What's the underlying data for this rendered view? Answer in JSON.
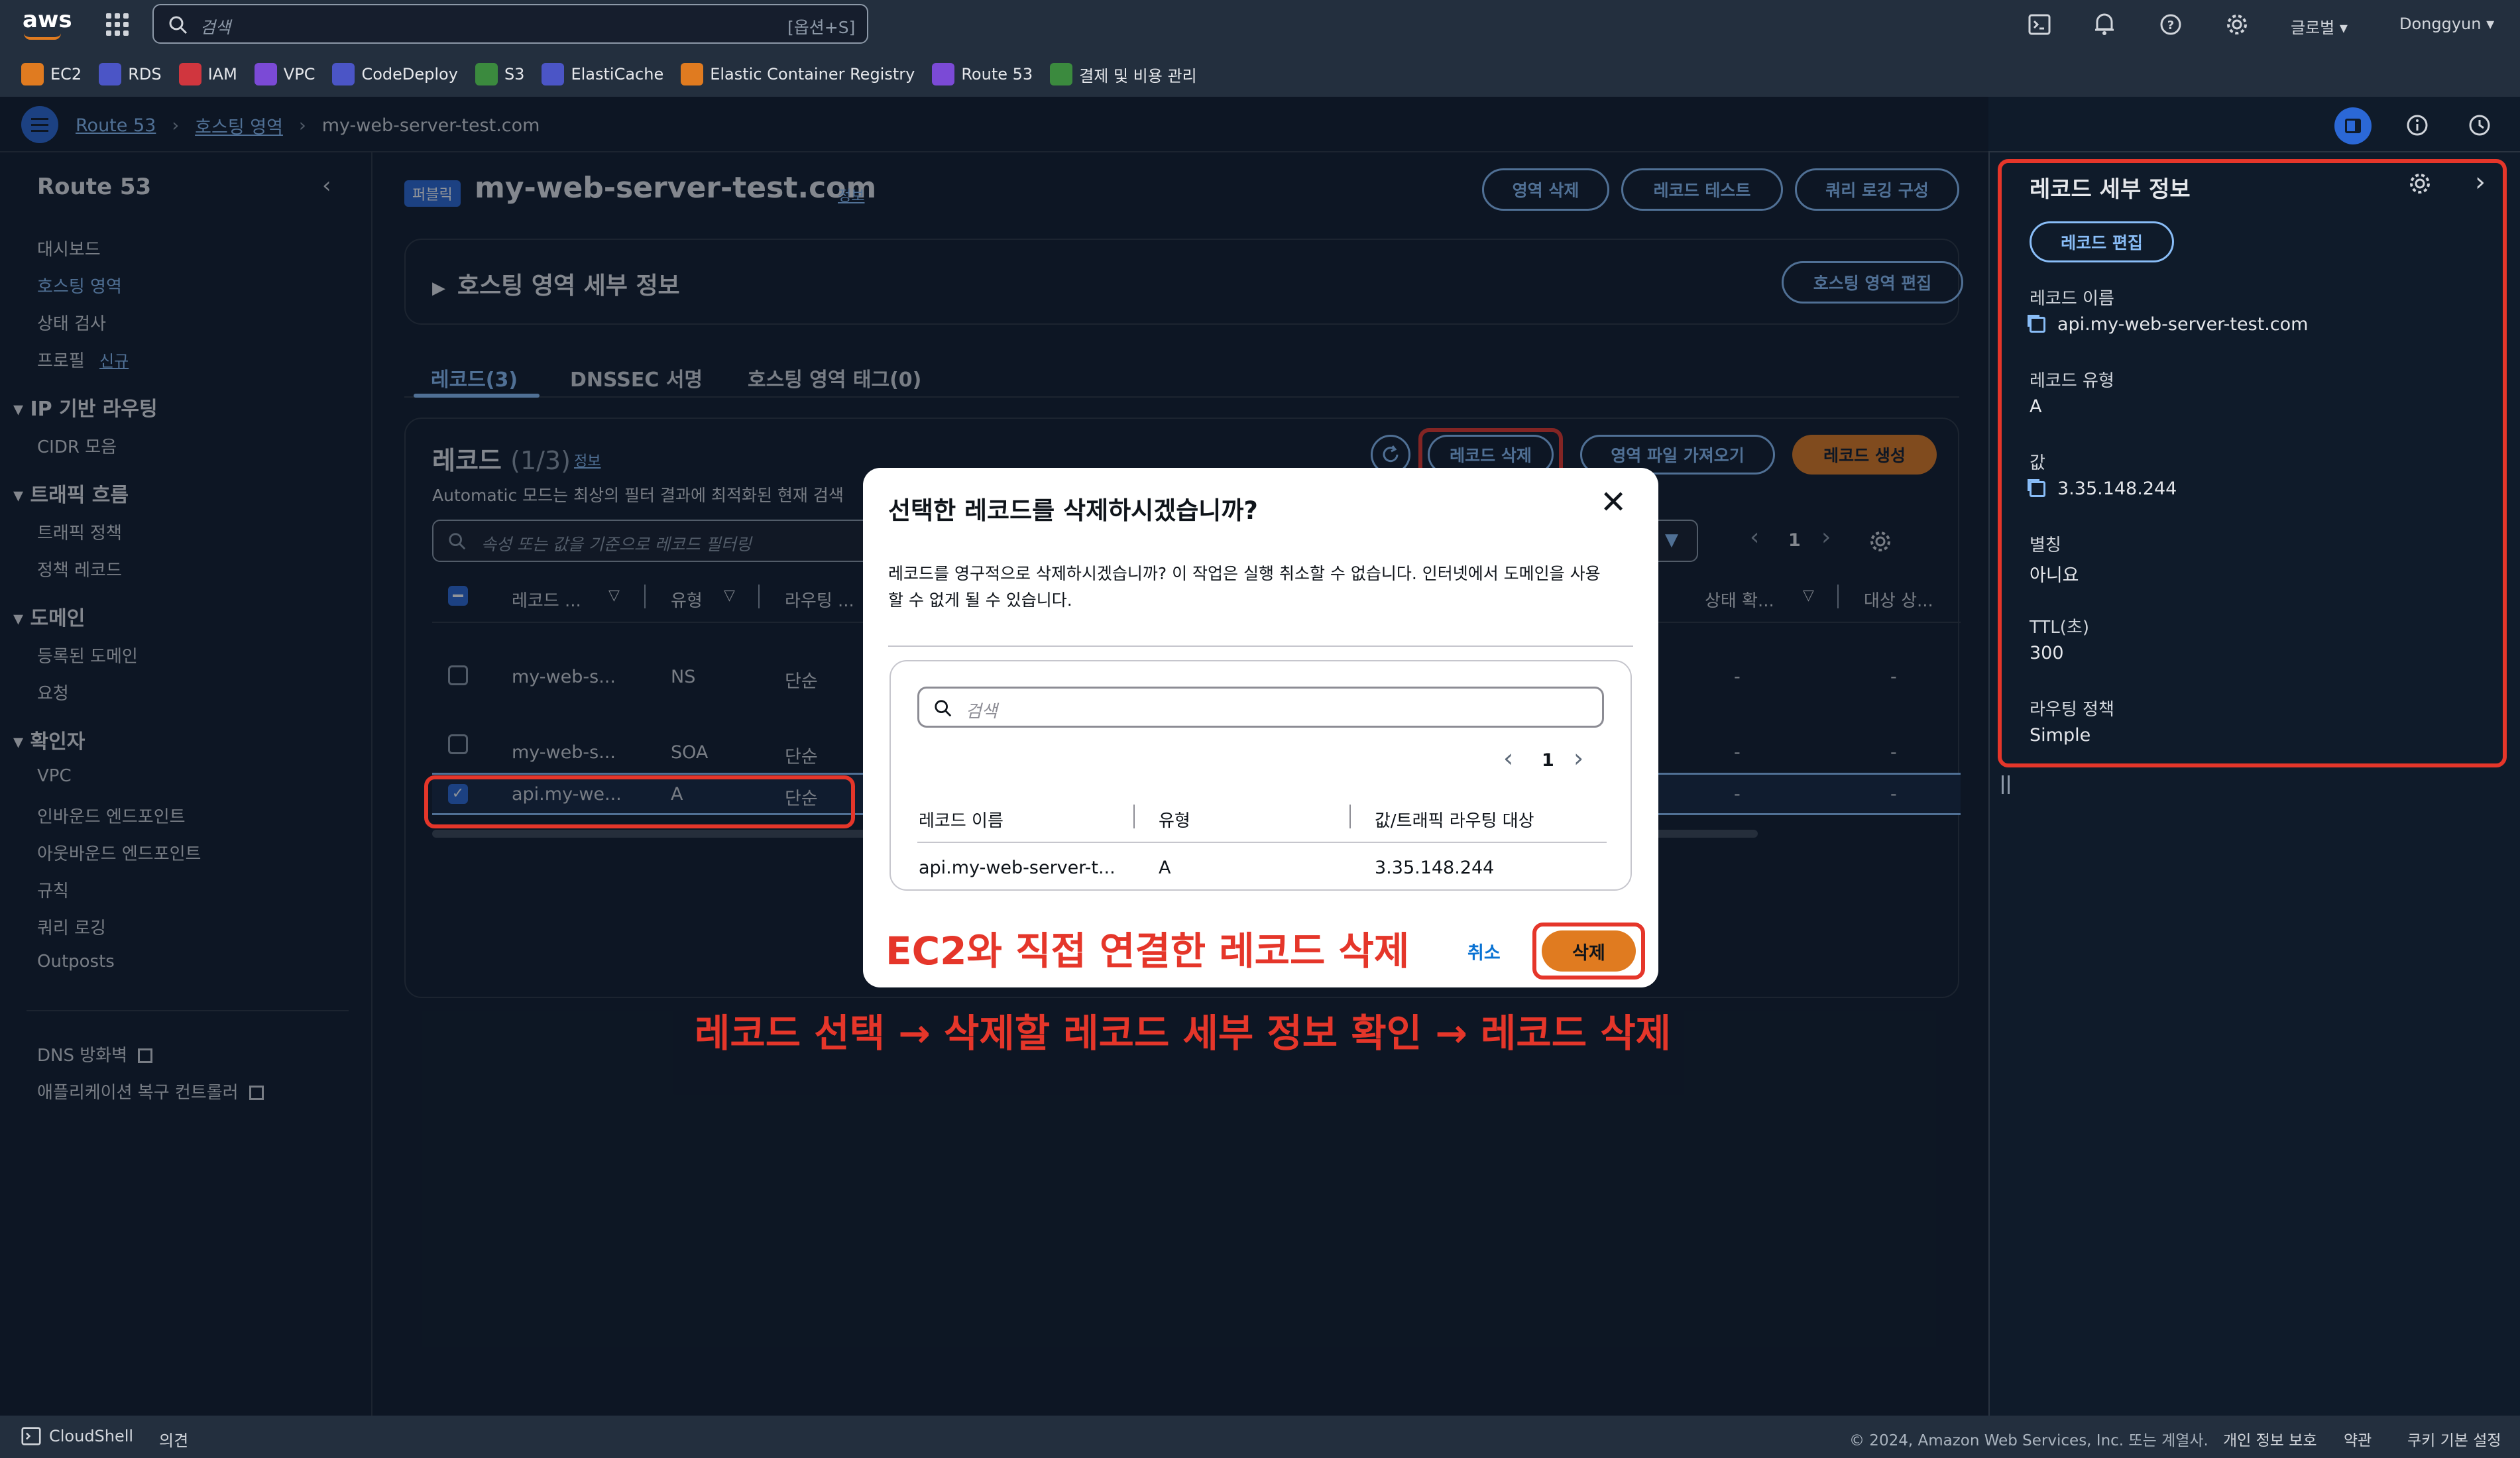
{
  "topnav": {
    "logo": "aws",
    "search_placeholder": "검색",
    "search_shortcut": "[옵션+S]",
    "region": "글로벌",
    "user": "Donggyun"
  },
  "favorites": [
    {
      "label": "EC2",
      "color": "#e07b20"
    },
    {
      "label": "RDS",
      "color": "#4b55c6"
    },
    {
      "label": "IAM",
      "color": "#d0363e"
    },
    {
      "label": "VPC",
      "color": "#7b4ad6"
    },
    {
      "label": "CodeDeploy",
      "color": "#4b55c6"
    },
    {
      "label": "S3",
      "color": "#3b8a3e"
    },
    {
      "label": "ElastiCache",
      "color": "#4b55c6"
    },
    {
      "label": "Elastic Container Registry",
      "color": "#e07b20"
    },
    {
      "label": "Route 53",
      "color": "#7b4ad6"
    },
    {
      "label": "결제 및 비용 관리",
      "color": "#3b8a3e"
    }
  ],
  "breadcrumb": {
    "items": [
      "Route 53",
      "호스팅 영역",
      "my-web-server-test.com"
    ]
  },
  "sidebar": {
    "title": "Route 53",
    "items": [
      "대시보드",
      "호스팅 영역",
      "상태 검사",
      "프로필"
    ],
    "new_badge": "신규",
    "sections": [
      {
        "title": "IP 기반 라우팅",
        "items": [
          "CIDR 모음"
        ]
      },
      {
        "title": "트래픽 흐름",
        "items": [
          "트래픽 정책",
          "정책 레코드"
        ]
      },
      {
        "title": "도메인",
        "items": [
          "등록된 도메인",
          "요청"
        ]
      },
      {
        "title": "확인자",
        "items": [
          "VPC",
          "인바운드 엔드포인트",
          "아웃바운드 엔드포인트",
          "규칙",
          "쿼리 로깅",
          "Outposts"
        ]
      }
    ],
    "links": [
      "DNS 방화벽",
      "애플리케이션 복구 컨트롤러"
    ]
  },
  "main": {
    "public_badge": "퍼블릭",
    "zone_title": "my-web-server-test.com",
    "info": "정보",
    "buttons": {
      "delete_zone": "영역 삭제",
      "test_record": "레코드 테스트",
      "query_logging": "쿼리 로깅 구성"
    },
    "details_header": "호스팅 영역 세부 정보",
    "edit_zone": "호스팅 영역 편집",
    "tabs": [
      "레코드(3)",
      "DNSSEC 서명",
      "호스팅 영역 태그(0)"
    ],
    "records": {
      "title": "레코드",
      "count": "(1/3)",
      "info": "정보",
      "description": "Automatic 모드는 최상의 필터 결과에 최적화된 현재 검색",
      "delete_btn": "레코드 삭제",
      "import_btn": "영역 파일 가져오기",
      "create_btn": "레코드 생성",
      "filter_placeholder": "속성 또는 값을 기준으로 레코드 필터링",
      "page": "1",
      "columns": [
        "레코드 ...",
        "유형",
        "라우팅 ...",
        "상태 확...",
        "대상 상..."
      ],
      "rows": [
        {
          "name": "my-web-s...",
          "type": "NS",
          "routing": "단순",
          "health": "-",
          "target": "-"
        },
        {
          "name": "my-web-s...",
          "type": "SOA",
          "routing": "단순",
          "health": "-",
          "target": "-"
        },
        {
          "name": "api.my-we...",
          "type": "A",
          "routing": "단순",
          "health": "-",
          "target": "-"
        }
      ]
    }
  },
  "right_panel": {
    "title": "레코드 세부 정보",
    "edit_btn": "레코드 편집",
    "fields": [
      {
        "label": "레코드 이름",
        "value": "api.my-web-server-test.com",
        "copy": true
      },
      {
        "label": "레코드 유형",
        "value": "A",
        "copy": false
      },
      {
        "label": "값",
        "value": "3.35.148.244",
        "copy": true
      },
      {
        "label": "별칭",
        "value": "아니요",
        "copy": false
      },
      {
        "label": "TTL(초)",
        "value": "300",
        "copy": false
      },
      {
        "label": "라우팅 정책",
        "value": "Simple",
        "copy": false
      }
    ]
  },
  "modal": {
    "title": "선택한 레코드를 삭제하시겠습니까?",
    "body_line1": "레코드를 영구적으로 삭제하시겠습니까? 이 작업은 실행 취소할 수 없습니다. 인터넷에서 도메인을 사용",
    "body_line2": "할 수 없게 될 수 있습니다.",
    "search_placeholder": "검색",
    "page": "1",
    "columns": [
      "레코드 이름",
      "유형",
      "값/트래픽 라우팅 대상"
    ],
    "row": {
      "name": "api.my-web-server-t...",
      "type": "A",
      "value": "3.35.148.244"
    },
    "cancel": "취소",
    "delete": "삭제"
  },
  "annotations": {
    "modal_caption": "EC2와 직접 연결한 레코드 삭제",
    "steps": "레코드 선택 → 삭제할 레코드 세부 정보 확인 → 레코드 삭제",
    "color": "#e5362a"
  },
  "footer": {
    "cloudshell": "CloudShell",
    "feedback": "의견",
    "copyright": "© 2024, Amazon Web Services, Inc. 또는 계열사.",
    "privacy": "개인 정보 보호",
    "terms": "약관",
    "cookies": "쿠키 기본 설정"
  }
}
